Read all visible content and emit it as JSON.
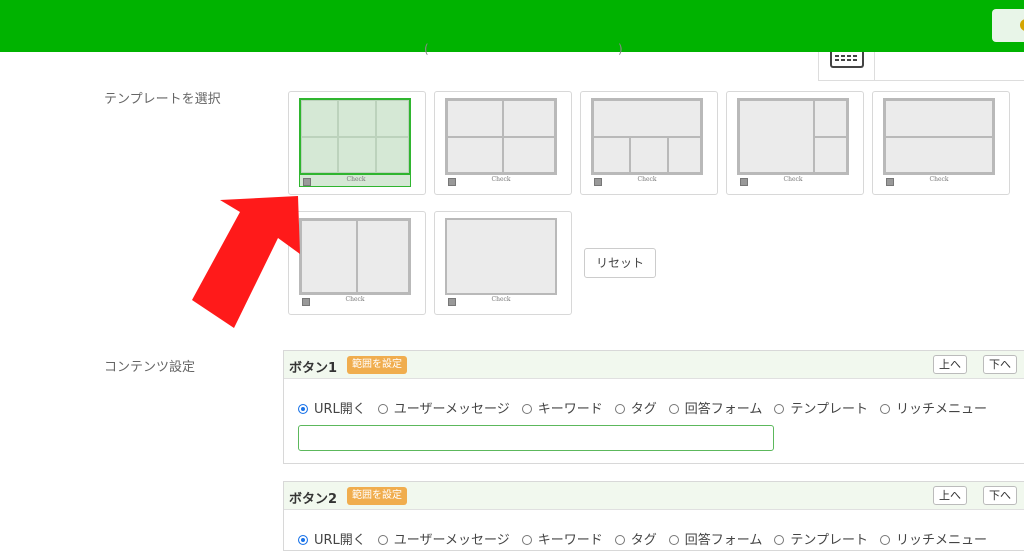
{
  "header": {
    "bg_color": "#00b300"
  },
  "template_section": {
    "label": "テンプレートを選択",
    "check_text": "Check",
    "reset_label": "リセット"
  },
  "content_section": {
    "label": "コンテンツ設定"
  },
  "buttons": [
    {
      "title": "ボタン1",
      "badge": "範囲を設定",
      "up_label": "上へ",
      "down_label": "下へ"
    },
    {
      "title": "ボタン2",
      "badge": "範囲を設定",
      "up_label": "上へ",
      "down_label": "下へ"
    }
  ],
  "action_options": [
    "URL開く",
    "ユーザーメッセージ",
    "キーワード",
    "タグ",
    "回答フォーム",
    "テンプレート",
    "リッチメニュー"
  ],
  "selected_option": "URL開く",
  "url_input": {
    "value": ""
  },
  "colors": {
    "accent_green": "#2fb52f",
    "badge_orange": "#f0ad4e",
    "arrow_red": "#ff1a1a"
  }
}
